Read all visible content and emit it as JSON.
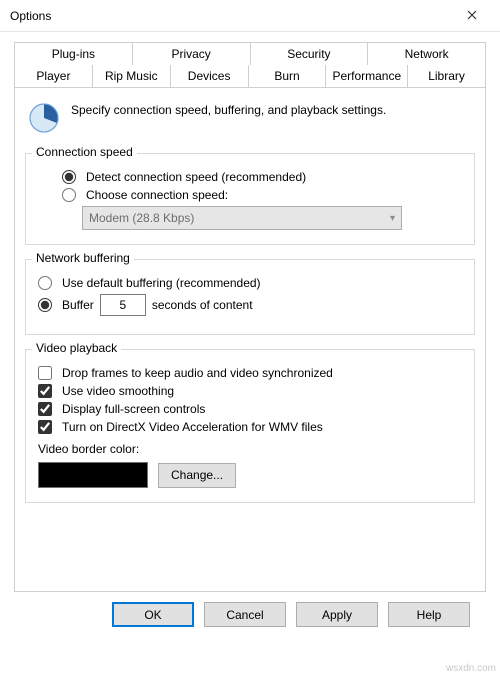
{
  "window": {
    "title": "Options"
  },
  "tabs": {
    "row1": [
      "Plug-ins",
      "Privacy",
      "Security",
      "Network"
    ],
    "row2": [
      "Player",
      "Rip Music",
      "Devices",
      "Burn",
      "Performance",
      "Library"
    ],
    "active": "Performance"
  },
  "panel": {
    "description": "Specify connection speed, buffering, and playback settings."
  },
  "connection": {
    "legend": "Connection speed",
    "detect_label": "Detect connection speed (recommended)",
    "choose_label": "Choose connection speed:",
    "combo_value": "Modem (28.8 Kbps)",
    "selected": "detect"
  },
  "buffering": {
    "legend": "Network buffering",
    "default_label": "Use default buffering (recommended)",
    "buffer_label": "Buffer",
    "buffer_value": "5",
    "buffer_suffix": "seconds of content",
    "selected": "buffer"
  },
  "playback": {
    "legend": "Video playback",
    "drop_frames": {
      "label": "Drop frames to keep audio and video synchronized",
      "checked": false
    },
    "smoothing": {
      "label": "Use video smoothing",
      "checked": true
    },
    "fullscreen": {
      "label": "Display full-screen controls",
      "checked": true
    },
    "dxva": {
      "label": "Turn on DirectX Video Acceleration for WMV files",
      "checked": true
    },
    "border_label": "Video border color:",
    "border_color": "#000000",
    "change_label": "Change..."
  },
  "buttons": {
    "ok": "OK",
    "cancel": "Cancel",
    "apply": "Apply",
    "help": "Help"
  },
  "watermark": "wsxdn.com"
}
